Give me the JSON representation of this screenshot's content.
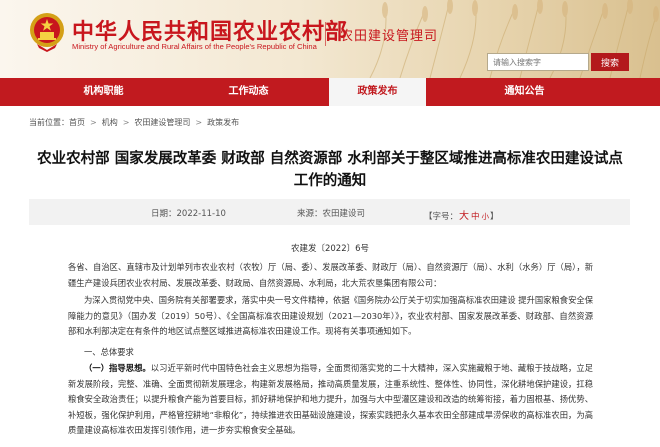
{
  "header": {
    "site_title": "中华人民共和国农业农村部",
    "site_subtitle": "Ministry of Agriculture and Rural Affairs of the People's Republic of China",
    "section_title": "农田建设管理司",
    "search_placeholder": "请输入搜索字",
    "search_button": "搜索"
  },
  "nav": {
    "items": [
      {
        "label": "机构职能"
      },
      {
        "label": "工作动态"
      },
      {
        "label": "政策发布"
      },
      {
        "label": "通知公告"
      }
    ],
    "active_index": 2
  },
  "breadcrumb": {
    "prefix": "当前位置：",
    "items": [
      "首页",
      "机构",
      "农田建设管理司",
      "政策发布"
    ],
    "separator": ">"
  },
  "article": {
    "title_line1": "农业农村部 国家发展改革委 财政部 自然资源部 水利部关于整区域推进高标准农田建设试点",
    "title_line2": "工作的通知",
    "date": "日期：2022-11-10",
    "source": "来源：农田建设司",
    "font_size_label": "【字号：",
    "font_size_large": "大",
    "font_size_medium": "中",
    "font_size_small": "小",
    "font_size_end": "】",
    "doc_number": "农建发〔2022〕6号",
    "recipients": "各省、自治区、直辖市及计划单列市农业农村（农牧）厅（局、委）、发展改革委、财政厅（局）、自然资源厅（局）、水利（水务）厅（局），新疆生产建设兵团农业农村局、发展改革委、财政局、自然资源局、水利局，北大荒农垦集团有限公司：",
    "intro": "为深入贯彻党中央、国务院有关部署要求，落实中央一号文件精神，依据《国务院办公厅关于切实加强高标准农田建设 提升国家粮食安全保障能力的意见》（国办发〔2019〕50号）、《全国高标准农田建设规划（2021—2030年）》，农业农村部、国家发展改革委、财政部、自然资源部和水利部决定在有条件的地区试点整区域推进高标准农田建设工作。现将有关事项通知如下。",
    "heading1": "一、总体要求",
    "principle_label": "（一）指导思想。",
    "principle_text": "以习近平新时代中国特色社会主义思想为指导，全面贯彻落实党的二十大精神，深入实施藏粮于地、藏粮于技战略，立足新发展阶段，完整、准确、全面贯彻新发展理念，构建新发展格局，推动高质量发展，注重系统性、整体性、协同性，深化耕地保护建设，扛稳粮食安全政治责任；以提升粮食产能为首要目标，抓好耕地保护和地力提升，加强与大中型灌区建设和改造的统筹衔接，着力固根基、扬优势、补短板，强化保护利用，严格管控耕地“非粮化”，持续推进农田基础设施建设，探索实践把永久基本农田全部建成旱涝保收的高标准农田，为高质量建设高标准农田发挥引领作用，进一步夯实粮食安全基础。"
  }
}
